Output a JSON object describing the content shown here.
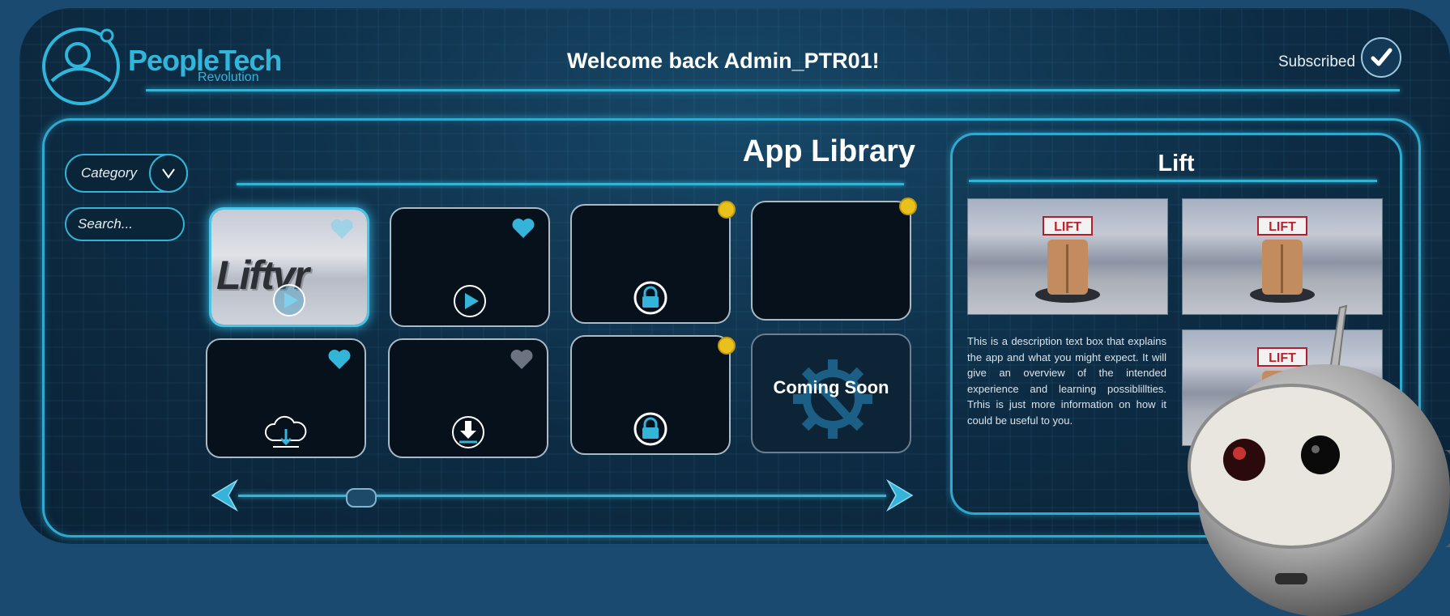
{
  "header": {
    "brand_name": "PeopleTech",
    "brand_sub": "Revolution",
    "welcome": "Welcome back Admin_PTR01!",
    "subscription_status": "Subscribed"
  },
  "filters": {
    "category_label": "Category",
    "search_placeholder": "Search..."
  },
  "library": {
    "title": "App Library",
    "tiles": [
      {
        "label": "Liftvr",
        "state": "selected",
        "favorite": true,
        "action": "play"
      },
      {
        "favorite": true,
        "action": "play"
      },
      {
        "action": "locked",
        "notification": true
      },
      {
        "notification": true
      },
      {
        "favorite": true,
        "action": "cloud-download"
      },
      {
        "favorite": false,
        "action": "download"
      },
      {
        "action": "locked",
        "notification": true
      },
      {
        "label": "Coming Soon",
        "action": "coming-soon"
      }
    ],
    "scroll_position": 0.2
  },
  "detail": {
    "title": "Lift",
    "sign_text": "LIFT",
    "description": "This is a description text box that explains the app and what you might expect. It will give an overview of the intended experience and learning possiblillties. Trhis is just more information on how it could be useful to you."
  },
  "colors": {
    "accent": "#33b3d6",
    "background": "#1a4a70",
    "notification": "#e8c11c",
    "tile_bg": "#06111b"
  }
}
